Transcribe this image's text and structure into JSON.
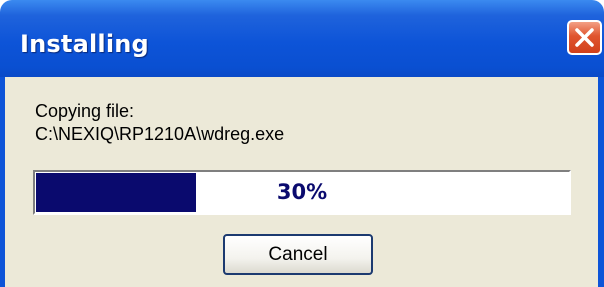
{
  "window": {
    "title": "Installing"
  },
  "message": {
    "line1": "Copying file:",
    "line2": "C:\\NEXIQ\\RP1210A\\wdreg.exe"
  },
  "progress": {
    "value": 0.3,
    "label": "30%"
  },
  "buttons": {
    "cancel": "Cancel"
  },
  "icons": {
    "close": "close-icon"
  },
  "colors": {
    "titlebar": "#0d54d8",
    "client": "#ece9d8",
    "progress_fill": "#0a0a6e",
    "close_button": "#e0552f"
  }
}
